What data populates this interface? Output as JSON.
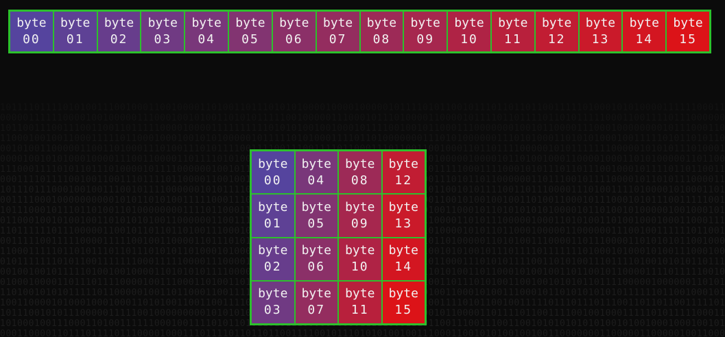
{
  "byte_word": "byte",
  "linear_bytes": [
    "00",
    "01",
    "02",
    "03",
    "04",
    "05",
    "06",
    "07",
    "08",
    "09",
    "10",
    "11",
    "12",
    "13",
    "14",
    "15"
  ],
  "matrix_rows": [
    [
      "00",
      "04",
      "08",
      "12"
    ],
    [
      "01",
      "05",
      "09",
      "13"
    ],
    [
      "02",
      "06",
      "10",
      "14"
    ],
    [
      "03",
      "07",
      "11",
      "15"
    ]
  ],
  "colors": {
    "grid_border": "#2cc12c",
    "gradient_start": "#55449e",
    "gradient_end": "#dc1318",
    "text": "#f2f2f2",
    "background": "#0b0b0b",
    "binary_pattern": "#1d1d1d"
  }
}
